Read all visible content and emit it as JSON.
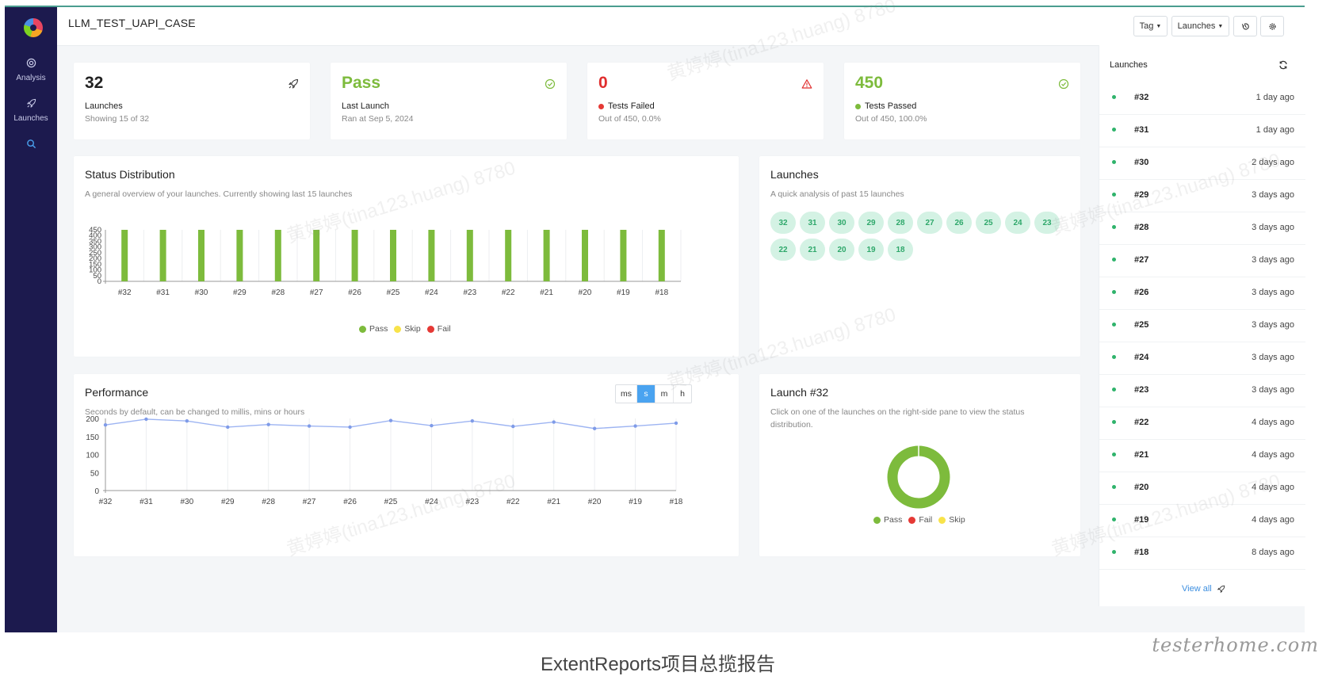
{
  "app": {
    "title": "LLM_TEST_UAPI_CASE",
    "caption": "ExtentReports项目总揽报告",
    "brand": "testerhome.com",
    "watermark": "黄婷婷(tina123.huang) 8780"
  },
  "sidebar": {
    "items": [
      {
        "label": "Analysis",
        "icon": "dashboard-icon"
      },
      {
        "label": "Launches",
        "icon": "rocket-icon"
      },
      {
        "label": "",
        "icon": "search-icon"
      }
    ]
  },
  "toolbar": {
    "tag_label": "Tag",
    "launches_label": "Launches",
    "history_icon": "history-icon",
    "settings_icon": "gear-icon"
  },
  "stats": {
    "launches": {
      "value": "32",
      "label": "Launches",
      "sub": "Showing 15 of 32",
      "icon": "rocket-icon"
    },
    "last": {
      "value": "Pass",
      "label": "Last Launch",
      "sub": "Ran at Sep 5, 2024",
      "icon": "check-circle-icon",
      "color": "#7dbb3c"
    },
    "failed": {
      "value": "0",
      "label": "Tests Failed",
      "sub": "Out of 450, 0.0%",
      "icon": "warning-icon",
      "color": "#e02e2e"
    },
    "passed": {
      "value": "450",
      "label": "Tests Passed",
      "sub": "Out of 450, 100.0%",
      "icon": "check-circle-icon",
      "color": "#7dbb3c"
    }
  },
  "status_dist": {
    "title": "Status Distribution",
    "subtitle": "A general overview of your launches. Currently showing last 15 launches"
  },
  "launches_quick": {
    "title": "Launches",
    "subtitle": "A quick analysis of past 15 launches",
    "chips": [
      "32",
      "31",
      "30",
      "29",
      "28",
      "27",
      "26",
      "25",
      "24",
      "23",
      "22",
      "21",
      "20",
      "19",
      "18"
    ]
  },
  "performance": {
    "title": "Performance",
    "subtitle": "Seconds by default, can be changed to millis, mins or hours",
    "units": [
      "ms",
      "s",
      "m",
      "h"
    ],
    "active_unit": "s"
  },
  "launch32": {
    "title": "Launch #32",
    "subtitle": "Click on one of the launches on the right-side pane to view the status distribution."
  },
  "legend": {
    "pass": "Pass",
    "skip": "Skip",
    "fail": "Fail"
  },
  "colors": {
    "pass": "#7dbb3c",
    "skip": "#f8e34a",
    "fail": "#e53935",
    "line": "#9db4f2",
    "accent": "#4aa3f0"
  },
  "chart_data": [
    {
      "type": "bar",
      "categories": [
        "#32",
        "#31",
        "#30",
        "#29",
        "#28",
        "#27",
        "#26",
        "#25",
        "#24",
        "#23",
        "#22",
        "#21",
        "#20",
        "#19",
        "#18"
      ],
      "series": [
        {
          "name": "Pass",
          "values": [
            450,
            450,
            450,
            450,
            450,
            450,
            450,
            450,
            450,
            450,
            450,
            450,
            450,
            450,
            450
          ]
        },
        {
          "name": "Skip",
          "values": [
            0,
            0,
            0,
            0,
            0,
            0,
            0,
            0,
            0,
            0,
            0,
            0,
            0,
            0,
            0
          ]
        },
        {
          "name": "Fail",
          "values": [
            0,
            0,
            0,
            0,
            0,
            0,
            0,
            0,
            0,
            0,
            0,
            0,
            0,
            0,
            0
          ]
        }
      ],
      "yticks": [
        0,
        50,
        100,
        150,
        200,
        250,
        300,
        350,
        400,
        450
      ],
      "ylim": [
        0,
        450
      ],
      "grid": "vertical",
      "legend": "bottom"
    },
    {
      "type": "line",
      "categories": [
        "#32",
        "#31",
        "#30",
        "#29",
        "#28",
        "#27",
        "#26",
        "#25",
        "#24",
        "#23",
        "#22",
        "#21",
        "#20",
        "#19",
        "#18"
      ],
      "values": [
        182,
        198,
        193,
        176,
        183,
        179,
        176,
        194,
        180,
        193,
        178,
        190,
        172,
        179,
        187
      ],
      "yticks": [
        0,
        50,
        100,
        150,
        200
      ],
      "ylim": [
        0,
        200
      ],
      "grid": "vertical"
    },
    {
      "type": "pie",
      "labels": [
        "Pass",
        "Fail",
        "Skip"
      ],
      "values": [
        450,
        0,
        0
      ],
      "legend": "bottom"
    }
  ],
  "right_panel": {
    "title": "Launches",
    "items": [
      {
        "name": "#32",
        "time": "1 day ago"
      },
      {
        "name": "#31",
        "time": "1 day ago"
      },
      {
        "name": "#30",
        "time": "2 days ago"
      },
      {
        "name": "#29",
        "time": "3 days ago"
      },
      {
        "name": "#28",
        "time": "3 days ago"
      },
      {
        "name": "#27",
        "time": "3 days ago"
      },
      {
        "name": "#26",
        "time": "3 days ago"
      },
      {
        "name": "#25",
        "time": "3 days ago"
      },
      {
        "name": "#24",
        "time": "3 days ago"
      },
      {
        "name": "#23",
        "time": "3 days ago"
      },
      {
        "name": "#22",
        "time": "4 days ago"
      },
      {
        "name": "#21",
        "time": "4 days ago"
      },
      {
        "name": "#20",
        "time": "4 days ago"
      },
      {
        "name": "#19",
        "time": "4 days ago"
      },
      {
        "name": "#18",
        "time": "8 days ago"
      }
    ],
    "view_all": "View all"
  }
}
